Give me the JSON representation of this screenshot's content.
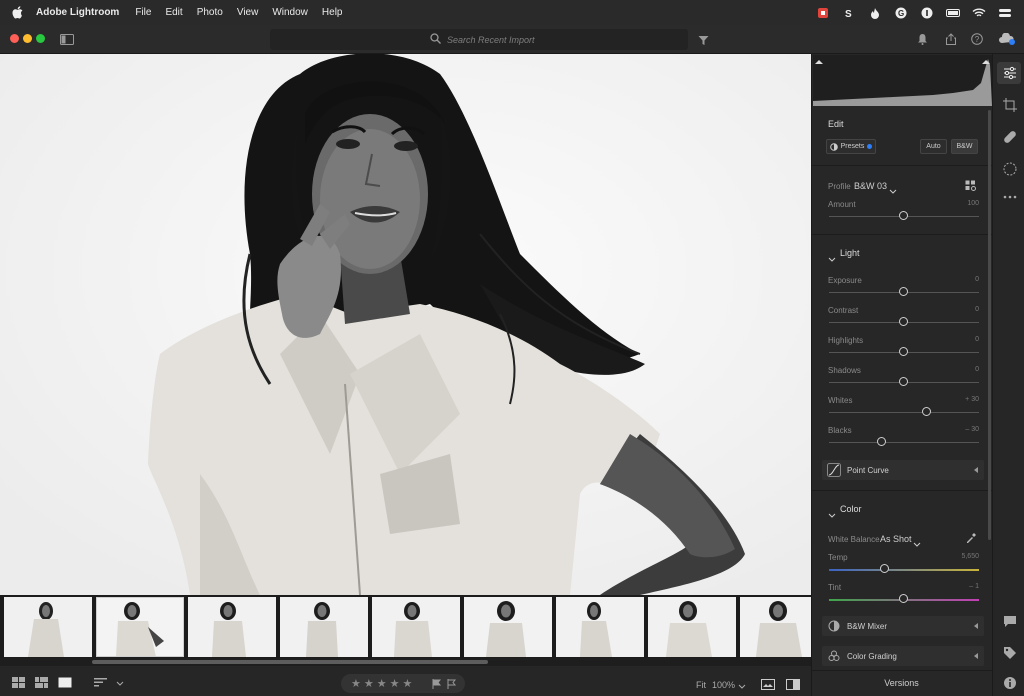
{
  "menubar": {
    "app_name": "Adobe Lightroom",
    "items": [
      "File",
      "Edit",
      "Photo",
      "View",
      "Window",
      "Help"
    ]
  },
  "toolbar": {
    "search_placeholder": "Search Recent Import"
  },
  "filmstrip": {
    "selected_index": 1,
    "thumb_count": 9
  },
  "bottombar": {
    "stars": [
      "★",
      "★",
      "★",
      "★",
      "★"
    ],
    "fit_label": "Fit",
    "zoom_label": "100%"
  },
  "panel": {
    "edit_title": "Edit",
    "presets_label": "Presets",
    "auto_label": "Auto",
    "bw_label": "B&W",
    "profile_label": "Profile",
    "profile_value": "B&W 03",
    "amount_label": "Amount",
    "amount_value": "100",
    "light_title": "Light",
    "light_sliders": [
      {
        "label": "Exposure",
        "value": "0",
        "level": 0.5
      },
      {
        "label": "Contrast",
        "value": "0",
        "level": 0.5
      },
      {
        "label": "Highlights",
        "value": "0",
        "level": 0.5
      },
      {
        "label": "Shadows",
        "value": "0",
        "level": 0.5
      },
      {
        "label": "Whites",
        "value": "+ 30",
        "level": 0.65
      },
      {
        "label": "Blacks",
        "value": "– 30",
        "level": 0.35
      }
    ],
    "point_curve_label": "Point Curve",
    "color_title": "Color",
    "white_balance_label": "White Balance",
    "white_balance_value": "As Shot",
    "temp_label": "Temp",
    "temp_value": "5,650",
    "tint_label": "Tint",
    "tint_value": "– 1",
    "bw_mixer_label": "B&W Mixer",
    "color_grading_label": "Color Grading",
    "versions_label": "Versions"
  },
  "colors": {
    "accent_blue": "#2d7ff9",
    "traffic_red": "#fe5f57",
    "traffic_yellow": "#febc2e",
    "traffic_green": "#28c840"
  }
}
